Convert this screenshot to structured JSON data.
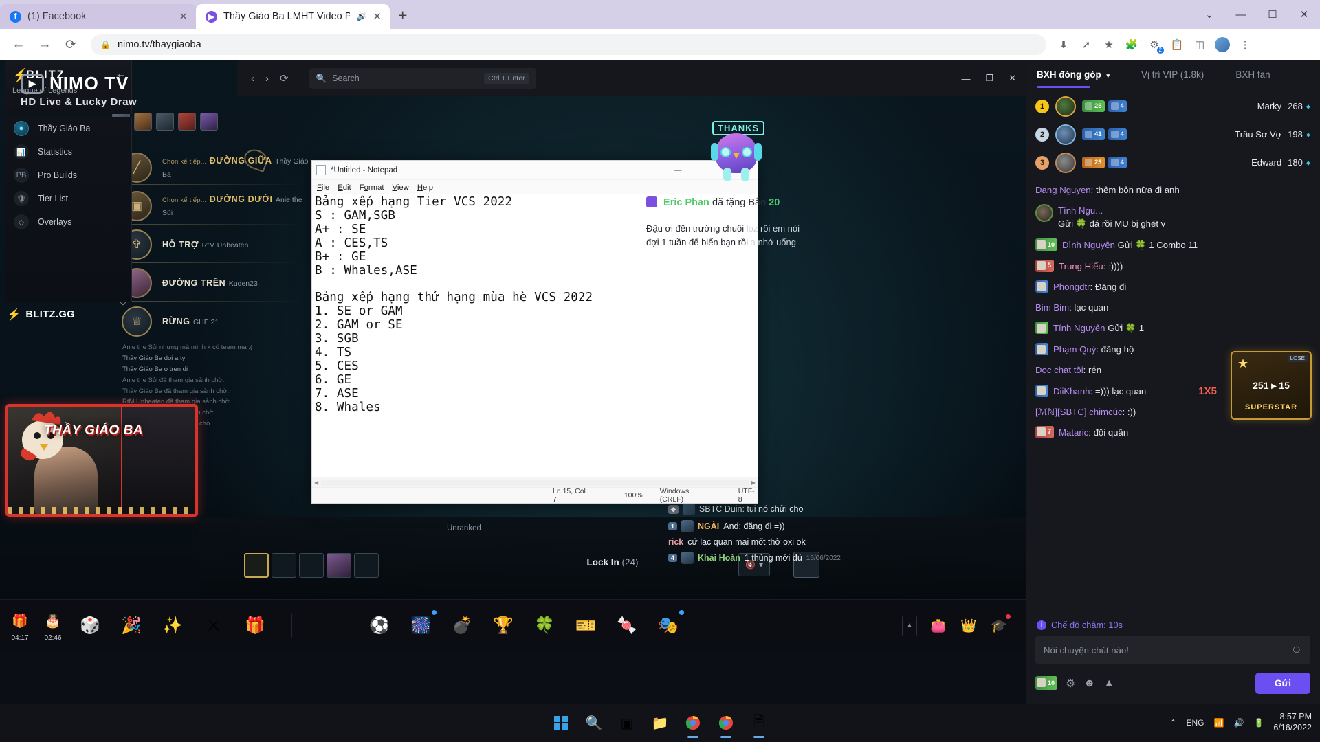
{
  "browser": {
    "tabs": [
      {
        "title": "(1) Facebook",
        "favicon": "facebook-icon",
        "active": false,
        "audio": false
      },
      {
        "title": "Thầy Giáo Ba LMHT Video Ph",
        "favicon": "nimo-icon",
        "active": true,
        "audio": true
      }
    ],
    "new_tab_label": "+",
    "window_controls": {
      "minimize": "—",
      "maximize": "☐",
      "close": "✕",
      "chevron": "⌄"
    },
    "nav": {
      "back": "←",
      "forward": "→",
      "reload": "⟳"
    },
    "url": "nimo.tv/thaygiaoba",
    "lock_icon": "lock-icon",
    "omni_icons": [
      "download-icon",
      "share-icon",
      "bookmark-star-icon",
      "puzzle-extension-icon",
      "extensions-icon",
      "reading-list-icon",
      "sidebar-icon",
      "profile-avatar",
      "menu-icon"
    ],
    "extension_badge": "2"
  },
  "notepad": {
    "title": "*Untitled - Notepad",
    "icon": "notepad-icon",
    "window_controls": {
      "minimize": "—",
      "maximize": "❐",
      "close": "✕"
    },
    "menu": [
      "File",
      "Edit",
      "Format",
      "View",
      "Help"
    ],
    "content": "Bảng xếp hạng Tier VCS 2022\nS : GAM,SGB\nA+ : SE\nA : CES,TS\nB+ : GE\nB : Whales,ASE\n\nBảng xếp hạng thứ hạng mùa hè VCS 2022\n1. SE or GAM\n2. GAM or SE\n3. SGB\n4. TS\n5. CES\n6. GE\n7. ASE\n8. Whales",
    "status": {
      "position": "Ln 15, Col 7",
      "zoom": "100%",
      "line_ending": "Windows (CRLF)",
      "encoding": "UTF-8"
    }
  },
  "nimo_player": {
    "nav": {
      "prev": "‹",
      "next": "›",
      "refresh": "⟳"
    },
    "search_placeholder": "Search",
    "search_icon": "search-icon",
    "search_shortcut": "Ctrl + Enter",
    "window_controls": {
      "minimize": "—",
      "maximize": "❐",
      "close": "✕"
    }
  },
  "blitz": {
    "brand": "BLITZ",
    "bolt_icon": "lightning-bolt-icon",
    "game": "League of Legends",
    "collapse_icon": "collapse-icon",
    "nav_items": [
      {
        "label": "Thầy Giáo Ba",
        "icon": "champion-avatar-icon"
      },
      {
        "label": "Statistics",
        "icon": "bar-chart-icon"
      },
      {
        "label": "Pro Builds",
        "icon": "pro-builds-icon"
      },
      {
        "label": "Tier List",
        "icon": "shield-icon"
      },
      {
        "label": "Overlays",
        "icon": "layers-icon"
      }
    ],
    "watermark": "BLITZ.GG"
  },
  "nimo_banner": {
    "brand": "NIMO TV",
    "tagline": "HD Live & Lucky Draw",
    "logo_icon": "nimo-logo-icon"
  },
  "champ_select": {
    "picks": [
      {
        "hint": "Chọn kế tiếp...",
        "role": "ĐƯỜNG GIỮA",
        "player": "Thầy Giáo Ba",
        "bar": "gold",
        "icon": "mid-lane-icon"
      },
      {
        "hint": "Chọn kế tiếp...",
        "role": "ĐƯỜNG DƯỚI",
        "player": "Anie the Sủi",
        "bar": "blue",
        "icon": "bot-lane-icon"
      },
      {
        "hint": "",
        "role": "HỖ TRỢ",
        "player": "RtM.Unbeaten",
        "bar": "",
        "icon": "support-icon"
      },
      {
        "hint": "",
        "role": "ĐƯỜNG TRÊN",
        "player": "Kuden23",
        "bar": "",
        "icon": "top-lane-icon"
      },
      {
        "hint": "",
        "role": "RỪNG",
        "player": "GHE 21",
        "bar": "",
        "icon": "jungle-icon"
      }
    ],
    "unranked_label": "Unranked",
    "lock_in_label": "Lock In",
    "lock_in_count": "(24)",
    "mute_icon": "mute-icon",
    "chevron_icon": "chevron-down-icon"
  },
  "overlay_chat": [
    {
      "text": "Anie the Sủi nhưng mà mình k có team ma :(",
      "type": "dim"
    },
    {
      "text": "Thầy Giáo Ba doi a ty",
      "type": "normal"
    },
    {
      "text": "Thầy Giáo Ba o tren di",
      "type": "normal"
    },
    {
      "text": "Anie the Sủi đã tham gia sảnh chờ.",
      "type": "dim"
    },
    {
      "text": "Thầy Giáo Ba đã tham gia sảnh chờ.",
      "type": "dim"
    },
    {
      "text": "RtM.Unbeaten đã tham gia sảnh chờ.",
      "type": "dim"
    },
    {
      "text": "Kuden23 đã tham gia sảnh chờ.",
      "type": "dim"
    },
    {
      "text": "GHE 21 đã tham gia sảnh chờ.",
      "type": "dim"
    }
  ],
  "facecam": {
    "title": "THẦY GIÁO BA",
    "mascot_icon": "rooster-mascot-icon"
  },
  "game_chat": [
    {
      "badge": "",
      "name": "",
      "text": "SBTC Duin: tụi nó chửi cho",
      "time": ""
    },
    {
      "badge": "1",
      "name": "NGÀI",
      "text": "And: đăng đi =))",
      "time": ""
    },
    {
      "badge": "",
      "name": "rick",
      "text": "cứ lạc quan mai mốt thở oxi ok",
      "time": ""
    },
    {
      "badge": "4",
      "name": "Khải Hoàn",
      "text": "1 thùng mới đủ",
      "time": "16/06/2022"
    }
  ],
  "gift_bar": {
    "timers": [
      {
        "icon": "treasure-chest-icon",
        "time": "04:17"
      },
      {
        "icon": "gift-box-icon",
        "time": "02:46"
      }
    ],
    "left_gifts": [
      "dice-icon",
      "confetti-icon",
      "sparkles-icon",
      "crossed-icon",
      "gift-icon"
    ],
    "center_gifts": [
      "soccer-ball-icon",
      "fireworks-icon",
      "bomb-icon",
      "trophy-icon",
      "clover-icon",
      "ticket-icon",
      "candy-icon",
      "mask-icon"
    ],
    "right_icons": [
      "wallet-icon",
      "crown-icon",
      "gift-shop-icon"
    ],
    "expand_icon": "chevron-up-icon"
  },
  "sidebar": {
    "tabs": [
      {
        "label": "BXH đóng góp",
        "active": true,
        "caret": "▾"
      },
      {
        "label": "Vị trí VIP (1.8k)",
        "active": false
      },
      {
        "label": "BXH fan",
        "active": false
      }
    ],
    "leaderboard": [
      {
        "rank": "1",
        "name": "Marky",
        "value": "268",
        "badges": [
          {
            "type": "green",
            "label": "28"
          },
          {
            "type": "blue",
            "label": "4"
          }
        ],
        "diamond_icon": "diamond-icon"
      },
      {
        "rank": "2",
        "name": "Trâu Sợ Vợ",
        "value": "198",
        "badges": [
          {
            "type": "blue",
            "label": "41"
          },
          {
            "type": "blue",
            "label": "4"
          }
        ],
        "diamond_icon": "diamond-icon"
      },
      {
        "rank": "3",
        "name": "Edward",
        "value": "180",
        "badges": [
          {
            "type": "orange",
            "label": "23"
          },
          {
            "type": "blue",
            "label": "4"
          }
        ],
        "diamond_icon": "diamond-icon"
      }
    ],
    "messages": [
      {
        "user": "Dang Nguyen",
        "color": "violet",
        "text": "thêm bộn nữa đi anh",
        "avatar": false,
        "level": ""
      },
      {
        "user": "Tính Ngu...",
        "color": "violet",
        "text": "Gửi",
        "avatar": true,
        "level": "",
        "gift": "clover-icon",
        "extra": "đá rồi MU bị ghét v",
        "combo": "1X5"
      },
      {
        "user": "Đình Nguyên",
        "color": "violet",
        "text": "Gửi",
        "avatar": false,
        "level": "10",
        "gift": "clover-icon",
        "extra": "1 Combo 11"
      },
      {
        "user": "Trung Hiếu",
        "color": "pink",
        "text": ":))))",
        "avatar": false,
        "level": "5"
      },
      {
        "user": "Phongdtr",
        "color": "violet",
        "text": "Đăng đi",
        "avatar": false,
        "level": ""
      },
      {
        "user": "Bim Bim",
        "color": "violet",
        "text": "lạc quan",
        "avatar": false,
        "level": ""
      },
      {
        "user": "Tính Nguyên",
        "color": "violet",
        "text": "Gửi",
        "avatar": false,
        "level": "",
        "gift": "clover-icon",
        "extra": "1"
      },
      {
        "user": "Phạm Quý",
        "color": "violet",
        "text": "đăng hộ",
        "avatar": false,
        "level": ""
      },
      {
        "user": "Đọc chat tôi",
        "color": "violet",
        "text": "rén",
        "avatar": false,
        "level": ""
      },
      {
        "user": "DiiKhanh",
        "color": "violet",
        "text": "=))) lạc quan",
        "avatar": false,
        "level": ""
      },
      {
        "user": "[ℳℕ][SBTC] chimcúc",
        "color": "violet",
        "text": ":))",
        "avatar": false,
        "level": ""
      },
      {
        "user": "Mataric",
        "color": "violet",
        "text": "đội quân",
        "avatar": false,
        "level": "7"
      }
    ],
    "slow_mode": {
      "icon": "info-icon",
      "label": "Chế độ chậm: 10s"
    },
    "input_placeholder": "Nói chuyện chút nào!",
    "emoji_icon": "emoji-icon",
    "action_icons": [
      "level-badge-icon",
      "settings-gear-icon",
      "sticker-icon",
      "top-icon"
    ],
    "send_label": "Gửi",
    "superstar": {
      "number": "251 ▸ 15",
      "word": "SUPERSTAR",
      "lose_label": "LOSE",
      "star_icon": "star-icon"
    }
  },
  "taskbar": {
    "start_icon": "windows-start-icon",
    "items": [
      "search-icon",
      "task-view-icon",
      "file-explorer-icon",
      "chrome-icon",
      "chrome-active-icon",
      "notepad-icon"
    ],
    "tray": {
      "chevron": "⌃",
      "language": "ENG",
      "network_icon": "wifi-icon",
      "volume_icon": "volume-icon",
      "battery_icon": "battery-icon"
    },
    "clock": {
      "time": "8:57 PM",
      "date": "6/16/2022"
    }
  },
  "colors": {
    "accent_purple": "#6c4ff0",
    "chrome_tabstrip": "#d6cfe8",
    "notepad_bg": "#ffffff",
    "sidebar_bg": "#17181d",
    "gift_green": "#52c96a"
  }
}
